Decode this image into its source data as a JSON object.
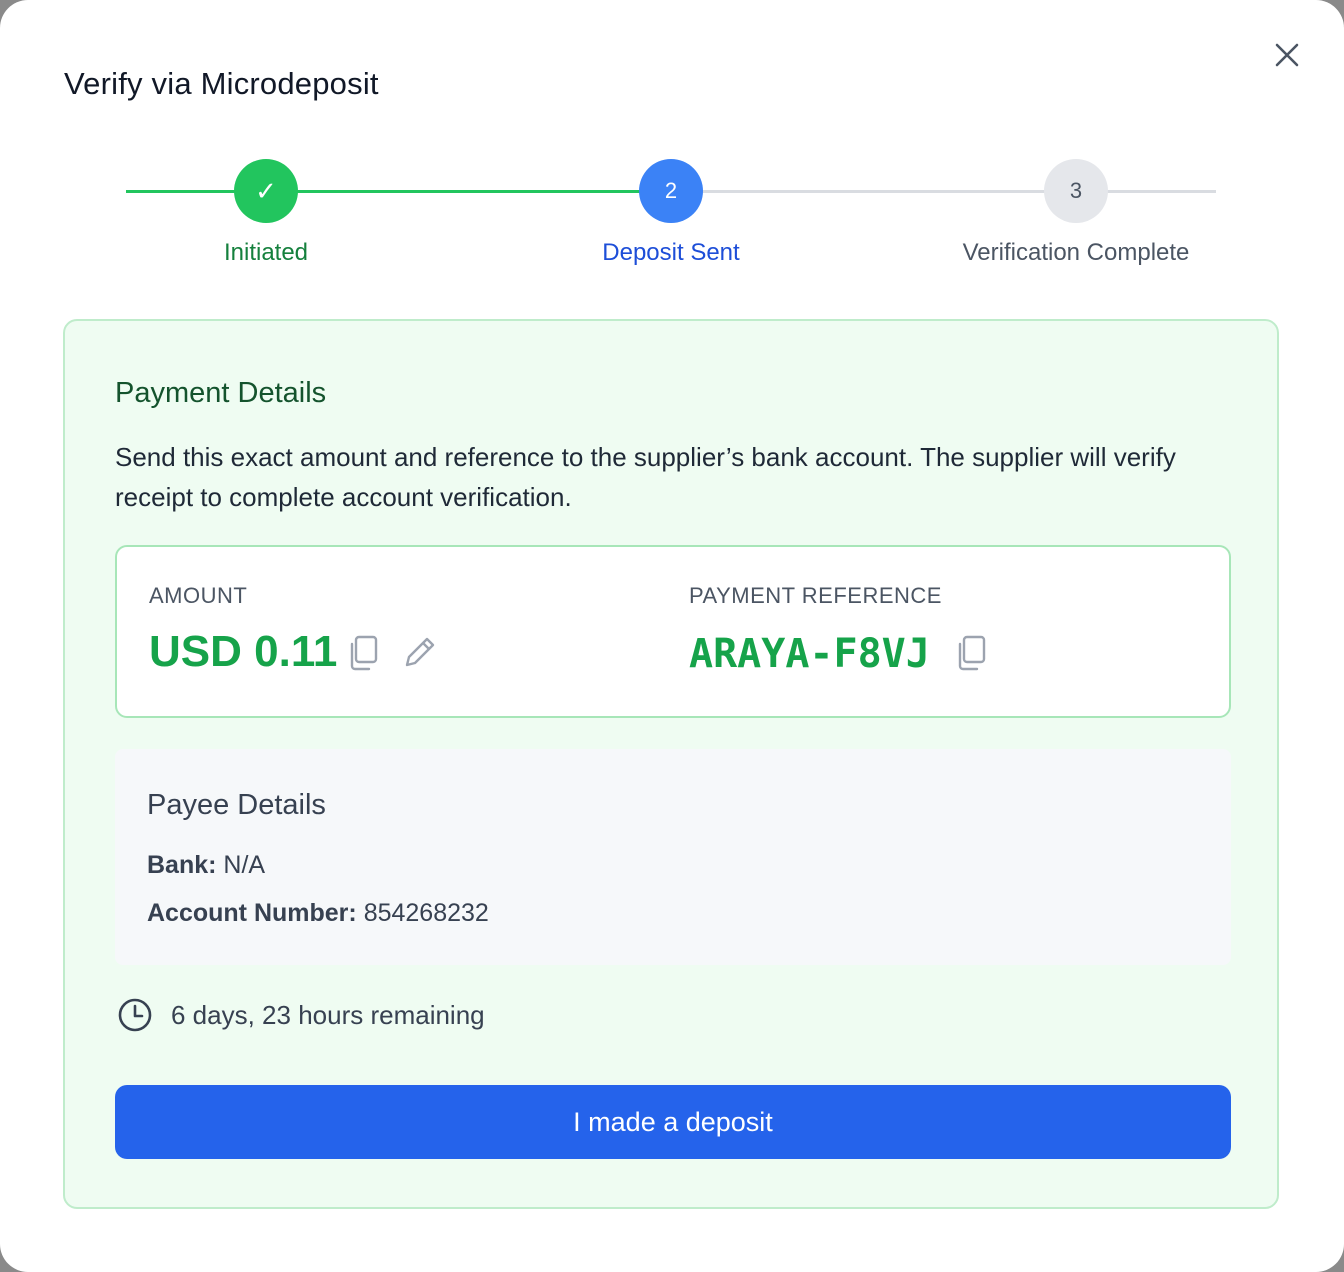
{
  "modal": {
    "title": "Verify via Microdeposit",
    "close_icon": "close-icon"
  },
  "stepper": {
    "steps": [
      {
        "marker": "✓",
        "label": "Initiated",
        "state": "done"
      },
      {
        "marker": "2",
        "label": "Deposit Sent",
        "state": "active"
      },
      {
        "marker": "3",
        "label": "Verification Complete",
        "state": "pending"
      }
    ]
  },
  "payment": {
    "heading": "Payment Details",
    "description": "Send this exact amount and reference to the supplier’s bank account. The supplier will verify receipt to complete account verification.",
    "amount_label": "AMOUNT",
    "amount_value": "USD 0.11",
    "reference_label": "PAYMENT REFERENCE",
    "reference_value": "ARAYA-F8VJ",
    "icons": {
      "copy": "copy-icon",
      "edit": "pencil-icon"
    }
  },
  "payee": {
    "heading": "Payee Details",
    "bank_key": "Bank:",
    "bank_value": "N/A",
    "account_key": "Account Number:",
    "account_value": "854268232"
  },
  "timer": {
    "icon": "clock-icon",
    "text": "6 days, 23 hours remaining"
  },
  "cta": {
    "label": "I made a deposit"
  },
  "colors": {
    "success": "#22c55e",
    "primary": "#2563eb",
    "card_bg": "#effcf2"
  }
}
